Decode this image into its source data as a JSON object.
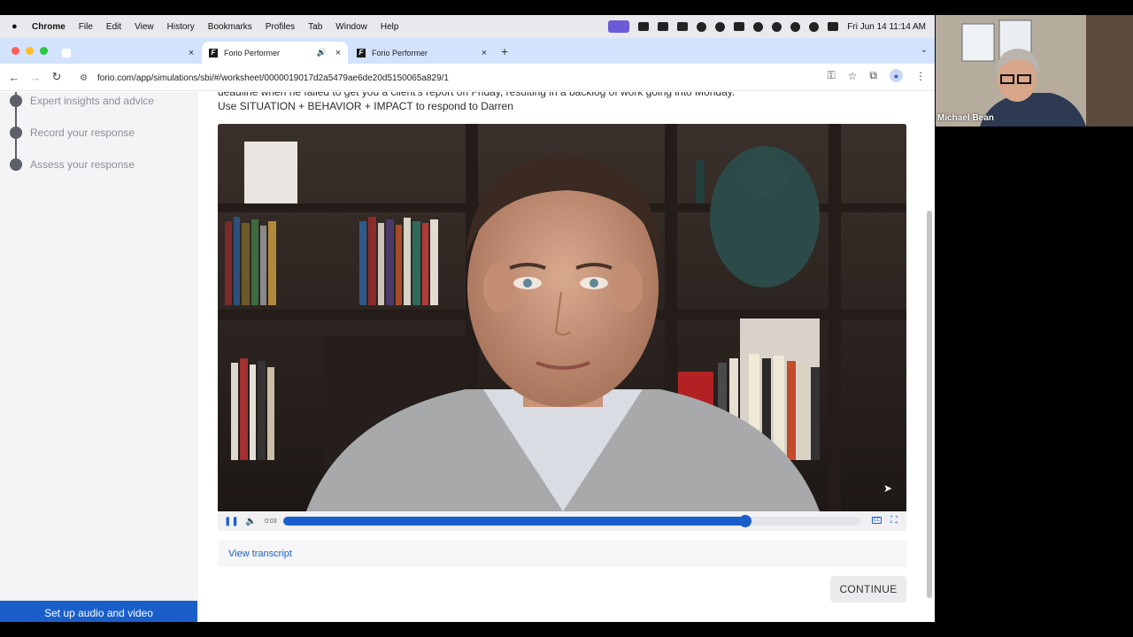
{
  "menubar": {
    "items": [
      "Chrome",
      "File",
      "Edit",
      "View",
      "History",
      "Bookmarks",
      "Profiles",
      "Tab",
      "Window",
      "Help"
    ],
    "clock": "Fri Jun 14  11:14 AM"
  },
  "tabs": [
    {
      "title": "",
      "close": "×"
    },
    {
      "title": "Forio Performer",
      "close": "×",
      "favicon": "F"
    },
    {
      "title": "Forio Performer",
      "close": "×",
      "favicon": "F"
    }
  ],
  "toolbar": {
    "url": "forio.com/app/simulations/sbi/#/worksheet/0000019017d2a5479ae6de20d5150065a829/1"
  },
  "sidebar": {
    "steps": [
      "Expert insights and advice",
      "Record your response",
      "Assess your response"
    ],
    "setup_button": "Set up audio and video"
  },
  "main": {
    "prompt_line1": "deadline when he failed to get you a client's report on Friday, resulting in a backlog of work going into Monday.",
    "prompt_line2": "Use SITUATION + BEHAVIOR + IMPACT to respond to Darren",
    "video_time": "0:03",
    "video_progress": 0.8,
    "cc_label": "CC",
    "transcript_link": "View transcript",
    "continue_button": "CONTINUE"
  },
  "webcam": {
    "name": "Michael Bean"
  },
  "colors": {
    "accent": "#1a5fc9",
    "sidebar_bg": "#f4f4f6",
    "tabstrip_bg": "#d3e3fd"
  }
}
